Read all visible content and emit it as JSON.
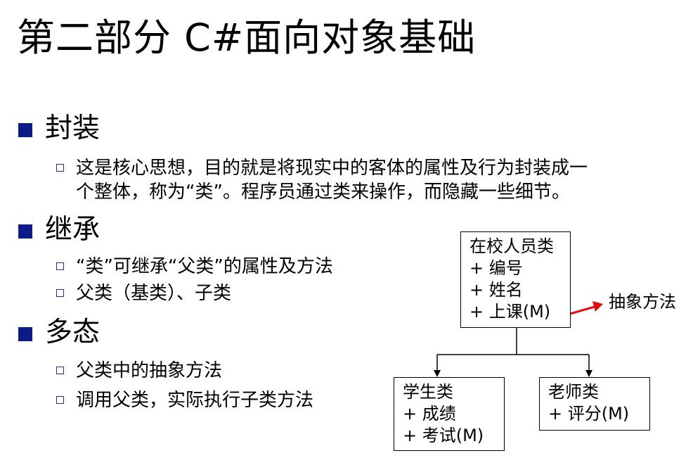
{
  "slide": {
    "title": "第二部分 C#面向对象基础",
    "sections": [
      {
        "heading": "封装",
        "items": [
          {
            "line1": "这是核心思想，目的就是将现实中的客体的属性及行为封装成一",
            "line2": "个整体，称为“类”。程序员通过类来操作，而隐藏一些细节。"
          }
        ]
      },
      {
        "heading": "继承",
        "items": [
          {
            "line1": "“类”可继承“父类”的属性及方法"
          },
          {
            "line1": "父类（基类）、子类"
          }
        ]
      },
      {
        "heading": "多态",
        "items": [
          {
            "line1": "父类中的抽象方法"
          },
          {
            "line1": "调用父类，实际执行子类方法"
          }
        ]
      }
    ]
  },
  "diagram": {
    "parent": {
      "name": "在校人员类",
      "members": [
        "+ 编号",
        "+ 姓名",
        "+ 上课(M)"
      ]
    },
    "children": [
      {
        "name": "学生类",
        "members": [
          "+ 成绩",
          "+ 考试(M)"
        ]
      },
      {
        "name": "老师类",
        "members": [
          "+ 评分(M)"
        ]
      }
    ],
    "annotation": "抽象方法",
    "colors": {
      "bullet_square": "#0d1a8a",
      "arrow": "#e01010"
    }
  }
}
